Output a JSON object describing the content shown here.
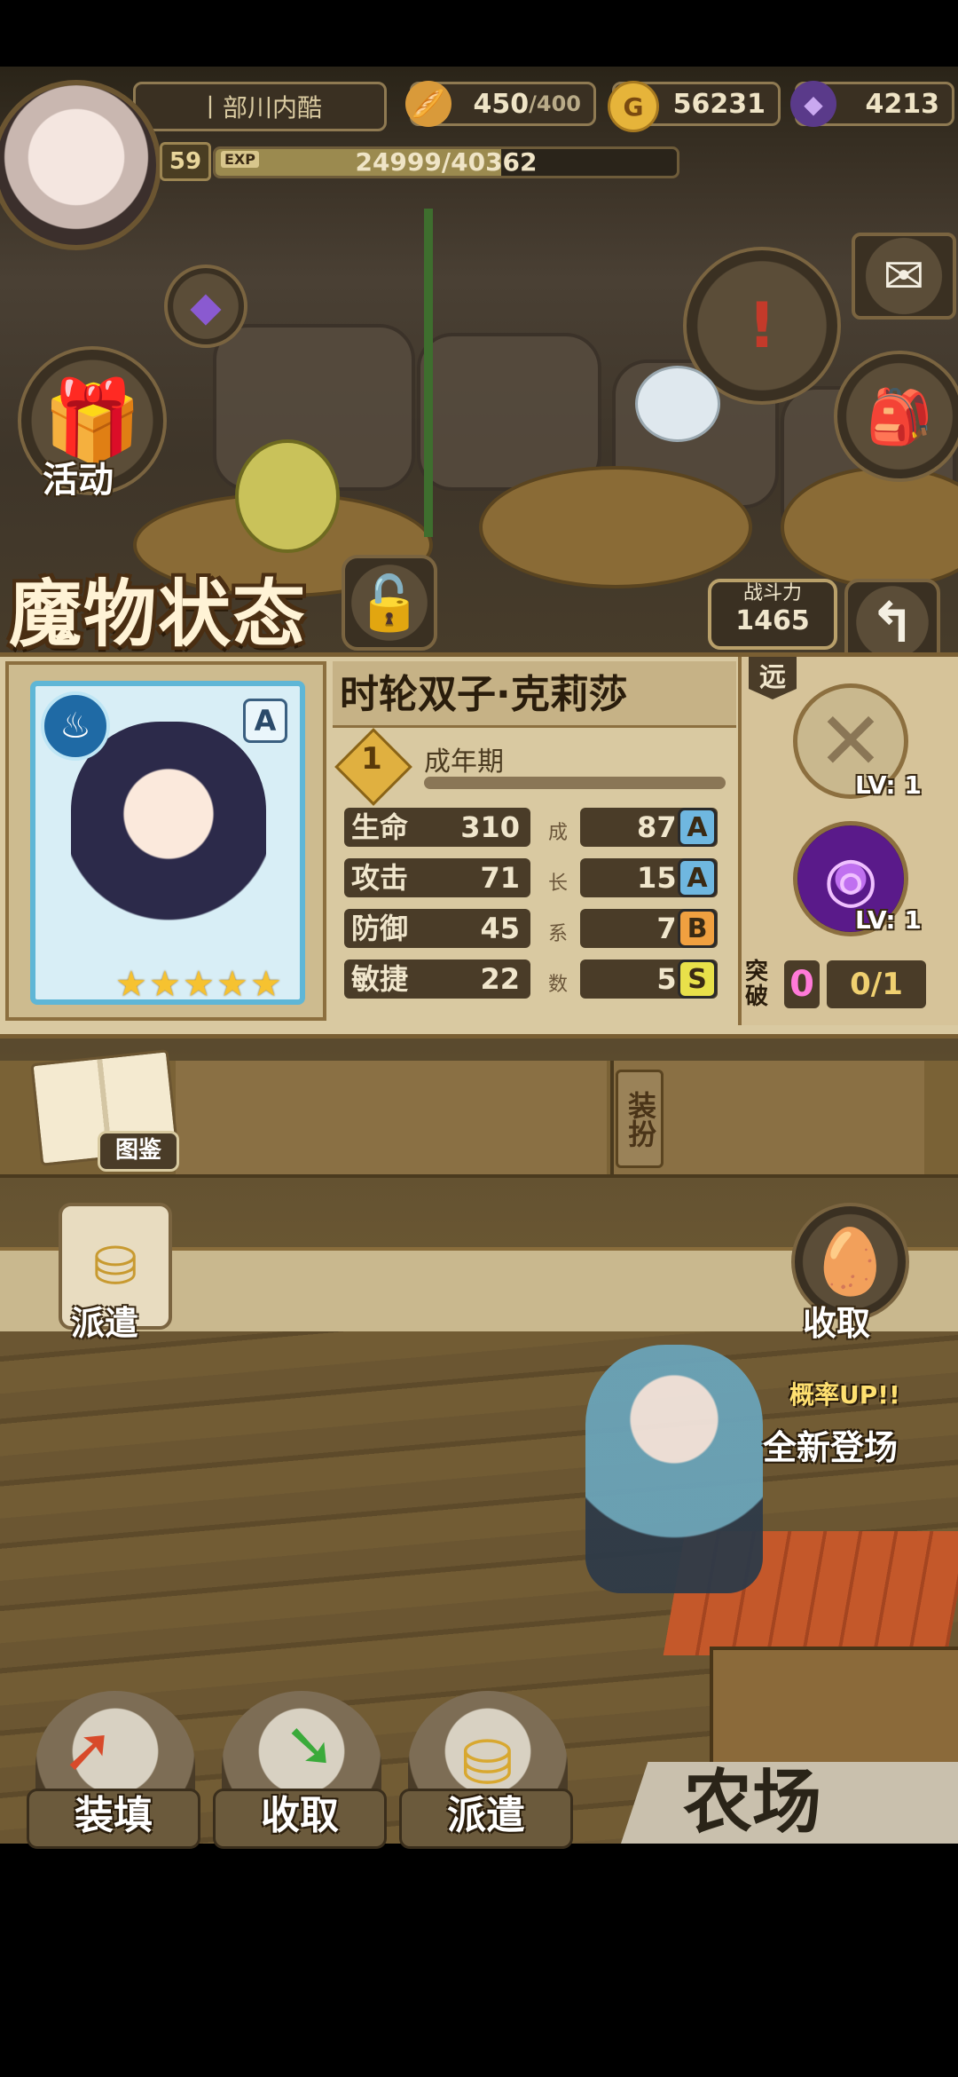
{
  "player": {
    "name": "丨部川内酷",
    "level": "59",
    "exp_tag": "EXP",
    "exp_text": "24999/40362",
    "exp_fraction": 0.62
  },
  "resources": {
    "stamina": "450",
    "stamina_max": "/400",
    "gold": "56231",
    "gold_icon": "G",
    "gems": "4213"
  },
  "side_buttons": {
    "event_label": "活动"
  },
  "panel": {
    "title": "魔物状态",
    "power_label": "战斗力",
    "power_value": "1465"
  },
  "monster": {
    "name": "时轮双子·克莉莎",
    "stage_num": "1",
    "stage_label": "成年期",
    "rank": "A",
    "stars": 5,
    "stats": [
      {
        "label": "生命",
        "value": "310",
        "growth": "87.6",
        "grade": "A",
        "grade_color": "#6fb7e0"
      },
      {
        "label": "攻击",
        "value": "71",
        "growth": "15.8",
        "grade": "A",
        "grade_color": "#6fb7e0"
      },
      {
        "label": "防御",
        "value": "45",
        "growth": "7.0",
        "grade": "B",
        "grade_color": "#f0a040"
      },
      {
        "label": "敏捷",
        "value": "22",
        "growth": "5.3",
        "grade": "S",
        "grade_color": "#e8e04a"
      }
    ],
    "growth_chars": [
      "成",
      "长",
      "系",
      "数"
    ]
  },
  "skills": {
    "range_label": "远",
    "slot1_lv": "LV: 1",
    "slot2_lv": "LV: 1",
    "break_label": "突破",
    "break_count": "0",
    "break_progress": "0/1"
  },
  "shelf": {
    "book_label": "图鉴",
    "equip_label": "装扮"
  },
  "farm_area": {
    "dispatch_label": "派遣",
    "collect_label": "收取",
    "banner_line1": "概率UP!!",
    "banner_line2": "全新登场"
  },
  "bottom": {
    "load_label": "装填",
    "collect_label": "收取",
    "dispatch_label": "派遣",
    "farm_label": "农场"
  },
  "colors": {
    "panel_bg": "#d9c9a1",
    "frame": "#8c6f3f",
    "accent_blue": "#5fb6d6"
  }
}
